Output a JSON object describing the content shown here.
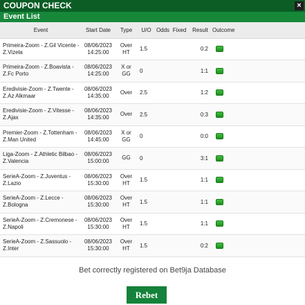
{
  "window": {
    "title": "COUPON CHECK",
    "close_label": "×"
  },
  "section": {
    "title": "Event List"
  },
  "table": {
    "headers": {
      "event": "Event",
      "start_date": "Start Date",
      "type": "Type",
      "uo": "U/O",
      "odds": "Odds",
      "fixed": "Fixed",
      "result": "Result",
      "outcome": "Outcome"
    },
    "rows": [
      {
        "event": "Primeira-Zoom - Z.Gil Vicente - Z.Vizela",
        "date": "08/06/2023",
        "time": "14:25:00",
        "type1": "Over",
        "type2": "HT",
        "uo": "1.5",
        "odds": "",
        "fixed": "",
        "result": "0:2",
        "outcome": "won"
      },
      {
        "event": "Primeira-Zoom - Z.Boavista - Z.Fc Porto",
        "date": "08/06/2023",
        "time": "14:25:00",
        "type1": "X or",
        "type2": "GG",
        "uo": "0",
        "odds": "",
        "fixed": "",
        "result": "1:1",
        "outcome": "won"
      },
      {
        "event": "Eredivisie-Zoom - Z.Twente - Z.Az Alkmaar",
        "date": "08/06/2023",
        "time": "14:35:00",
        "type1": "Over",
        "type2": "",
        "uo": "2.5",
        "odds": "",
        "fixed": "",
        "result": "1:2",
        "outcome": "won"
      },
      {
        "event": "Eredivisie-Zoom - Z.Vitesse - Z.Ajax",
        "date": "08/06/2023",
        "time": "14:35:00",
        "type1": "Over",
        "type2": "",
        "uo": "2.5",
        "odds": "",
        "fixed": "",
        "result": "0:3",
        "outcome": "won"
      },
      {
        "event": "Premier-Zoom - Z.Tottenham - Z.Man United",
        "date": "08/06/2023",
        "time": "14:45:00",
        "type1": "X or",
        "type2": "GG",
        "uo": "0",
        "odds": "",
        "fixed": "",
        "result": "0:0",
        "outcome": "won"
      },
      {
        "event": "Liga-Zoom - Z.Athletic Bilbao - Z.Valencia",
        "date": "08/06/2023",
        "time": "15:00:00",
        "type1": "GG",
        "type2": "",
        "uo": "0",
        "odds": "",
        "fixed": "",
        "result": "3:1",
        "outcome": "won"
      },
      {
        "event": "SerieA-Zoom - Z.Juventus - Z.Lazio",
        "date": "08/06/2023",
        "time": "15:30:00",
        "type1": "Over",
        "type2": "HT",
        "uo": "1.5",
        "odds": "",
        "fixed": "",
        "result": "1:1",
        "outcome": "won"
      },
      {
        "event": "SerieA-Zoom - Z.Lecce - Z.Bologna",
        "date": "08/06/2023",
        "time": "15:30:00",
        "type1": "Over",
        "type2": "HT",
        "uo": "1.5",
        "odds": "",
        "fixed": "",
        "result": "1:1",
        "outcome": "won"
      },
      {
        "event": "SerieA-Zoom - Z.Cremonese - Z.Napoli",
        "date": "08/06/2023",
        "time": "15:30:00",
        "type1": "Over",
        "type2": "HT",
        "uo": "1.5",
        "odds": "",
        "fixed": "",
        "result": "1:1",
        "outcome": "won"
      },
      {
        "event": "SerieA-Zoom - Z.Sassuolo - Z.Inter",
        "date": "08/06/2023",
        "time": "15:30:00",
        "type1": "Over",
        "type2": "HT",
        "uo": "1.5",
        "odds": "",
        "fixed": "",
        "result": "0:2",
        "outcome": "won"
      }
    ]
  },
  "footer": {
    "message": "Bet correctly registered on Bet9ja Database",
    "rebet_label": "Rebet"
  },
  "colors": {
    "title_bar": "#0b5d25",
    "sub_bar": "#17883a",
    "button": "#14823a",
    "won": "#2aa62a"
  },
  "icons": {
    "close": "close-icon",
    "outcome": "green-square-icon"
  }
}
